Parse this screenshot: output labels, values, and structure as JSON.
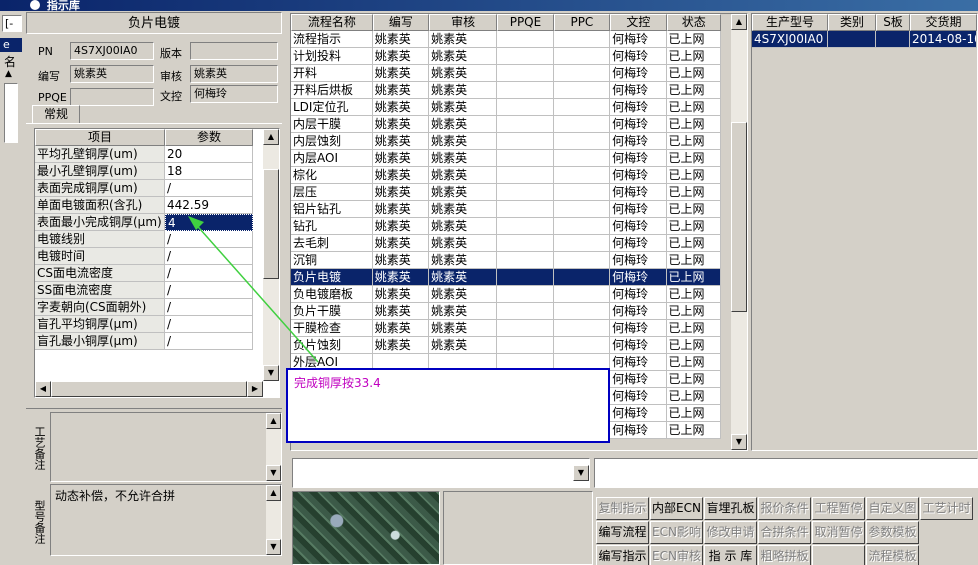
{
  "window": {
    "title": "指示库"
  },
  "left_strip": {
    "top_text": "[-",
    "tab_text": "e",
    "label": "名"
  },
  "left_panel": {
    "title": "负片电镀",
    "fields": {
      "pn_label": "PN",
      "pn_value": "4S7XJ00IA0",
      "version_label": "版本",
      "version_value": "",
      "author_label": "编写",
      "author_value": "姚素英",
      "reviewer_label": "审核",
      "reviewer_value": "姚素英",
      "ppqe_label": "PPQE",
      "ppqe_value": "",
      "doc_label": "文控",
      "doc_value": "何梅玲"
    },
    "tab_label": "常规",
    "params_grid": {
      "headers": [
        "项目",
        "参数"
      ],
      "rows": [
        [
          "平均孔壁铜厚(um)",
          "20"
        ],
        [
          "最小孔壁铜厚(um)",
          "18"
        ],
        [
          "表面完成铜厚(um)",
          "/"
        ],
        [
          "单面电镀面积(含孔)",
          "442.59"
        ],
        [
          "表面最小完成铜厚(μm)",
          "4"
        ],
        [
          "电镀线别",
          "/"
        ],
        [
          "电镀时间",
          "/"
        ],
        [
          "CS面电流密度",
          "/"
        ],
        [
          "SS面电流密度",
          "/"
        ],
        [
          "字麦朝向(CS面朝外)",
          "/"
        ],
        [
          "盲孔平均铜厚(μm)",
          "/"
        ],
        [
          "盲孔最小铜厚(μm)",
          "/"
        ]
      ],
      "selected_row": 4
    },
    "process_note_label": "工艺备注",
    "process_note_value": "",
    "model_note_label": "型号备注",
    "model_note_value": "动态补偿，不允许合拼"
  },
  "flow_grid": {
    "headers": [
      "流程名称",
      "编写",
      "审核",
      "PPQE",
      "PPC",
      "文控",
      "状态"
    ],
    "rows": [
      [
        "流程指示",
        "姚素英",
        "姚素英",
        "",
        "",
        "何梅玲",
        "已上网"
      ],
      [
        "计划投料",
        "姚素英",
        "姚素英",
        "",
        "",
        "何梅玲",
        "已上网"
      ],
      [
        "开料",
        "姚素英",
        "姚素英",
        "",
        "",
        "何梅玲",
        "已上网"
      ],
      [
        "开料后烘板",
        "姚素英",
        "姚素英",
        "",
        "",
        "何梅玲",
        "已上网"
      ],
      [
        "LDI定位孔",
        "姚素英",
        "姚素英",
        "",
        "",
        "何梅玲",
        "已上网"
      ],
      [
        "内层干膜",
        "姚素英",
        "姚素英",
        "",
        "",
        "何梅玲",
        "已上网"
      ],
      [
        "内层蚀刻",
        "姚素英",
        "姚素英",
        "",
        "",
        "何梅玲",
        "已上网"
      ],
      [
        "内层AOI",
        "姚素英",
        "姚素英",
        "",
        "",
        "何梅玲",
        "已上网"
      ],
      [
        "棕化",
        "姚素英",
        "姚素英",
        "",
        "",
        "何梅玲",
        "已上网"
      ],
      [
        "层压",
        "姚素英",
        "姚素英",
        "",
        "",
        "何梅玲",
        "已上网"
      ],
      [
        "铝片钻孔",
        "姚素英",
        "姚素英",
        "",
        "",
        "何梅玲",
        "已上网"
      ],
      [
        "钻孔",
        "姚素英",
        "姚素英",
        "",
        "",
        "何梅玲",
        "已上网"
      ],
      [
        "去毛刺",
        "姚素英",
        "姚素英",
        "",
        "",
        "何梅玲",
        "已上网"
      ],
      [
        "沉铜",
        "姚素英",
        "姚素英",
        "",
        "",
        "何梅玲",
        "已上网"
      ],
      [
        "负片电镀",
        "姚素英",
        "姚素英",
        "",
        "",
        "何梅玲",
        "已上网"
      ],
      [
        "负电镀磨板",
        "姚素英",
        "姚素英",
        "",
        "",
        "何梅玲",
        "已上网"
      ],
      [
        "负片干膜",
        "姚素英",
        "姚素英",
        "",
        "",
        "何梅玲",
        "已上网"
      ],
      [
        "干膜检查",
        "姚素英",
        "姚素英",
        "",
        "",
        "何梅玲",
        "已上网"
      ],
      [
        "负片蚀刻",
        "姚素英",
        "姚素英",
        "",
        "",
        "何梅玲",
        "已上网"
      ],
      [
        "外层AOI",
        "",
        "",
        "",
        "",
        "何梅玲",
        "已上网"
      ],
      [
        "",
        "",
        "",
        "",
        "",
        "何梅玲",
        "已上网"
      ],
      [
        "",
        "",
        "",
        "",
        "",
        "何梅玲",
        "已上网"
      ],
      [
        "",
        "",
        "",
        "",
        "",
        "何梅玲",
        "已上网"
      ],
      [
        "",
        "",
        "",
        "",
        "",
        "何梅玲",
        "已上网"
      ]
    ],
    "selected_row": 14
  },
  "product_grid": {
    "headers": [
      "生产型号",
      "类别",
      "S板",
      "交货期"
    ],
    "rows": [
      [
        "4S7XJ00IA0",
        "",
        "",
        "2014-08-10"
      ]
    ]
  },
  "annotation": {
    "text": "完成铜厚按33.4"
  },
  "buttons": {
    "row1": [
      {
        "label": "复制指示",
        "enabled": false
      },
      {
        "label": "内部ECN",
        "enabled": true
      },
      {
        "label": "盲埋孔板",
        "enabled": true
      },
      {
        "label": "报价条件",
        "enabled": false
      },
      {
        "label": "工程暂停",
        "enabled": false
      },
      {
        "label": "自定义图",
        "enabled": false
      },
      {
        "label": "工艺计时",
        "enabled": false
      }
    ],
    "row2": [
      {
        "label": "编写流程",
        "enabled": true
      },
      {
        "label": "ECN影响",
        "enabled": false
      },
      {
        "label": "修改申请",
        "enabled": false
      },
      {
        "label": "合拼条件",
        "enabled": false
      },
      {
        "label": "取消暂停",
        "enabled": false
      },
      {
        "label": "参数模板",
        "enabled": false
      }
    ],
    "row3": [
      {
        "label": "编写指示",
        "enabled": true
      },
      {
        "label": "ECN审核",
        "enabled": false
      },
      {
        "label": "指 示 库",
        "enabled": true
      },
      {
        "label": "粗略拼板",
        "enabled": false
      },
      {
        "label": "",
        "enabled": false
      },
      {
        "label": "流程模板",
        "enabled": false
      }
    ]
  },
  "colors": {
    "selection": "#0a246a",
    "annotation_border": "#0000c0",
    "annotation_text": "#c000c0",
    "arrow": "#40d040"
  }
}
